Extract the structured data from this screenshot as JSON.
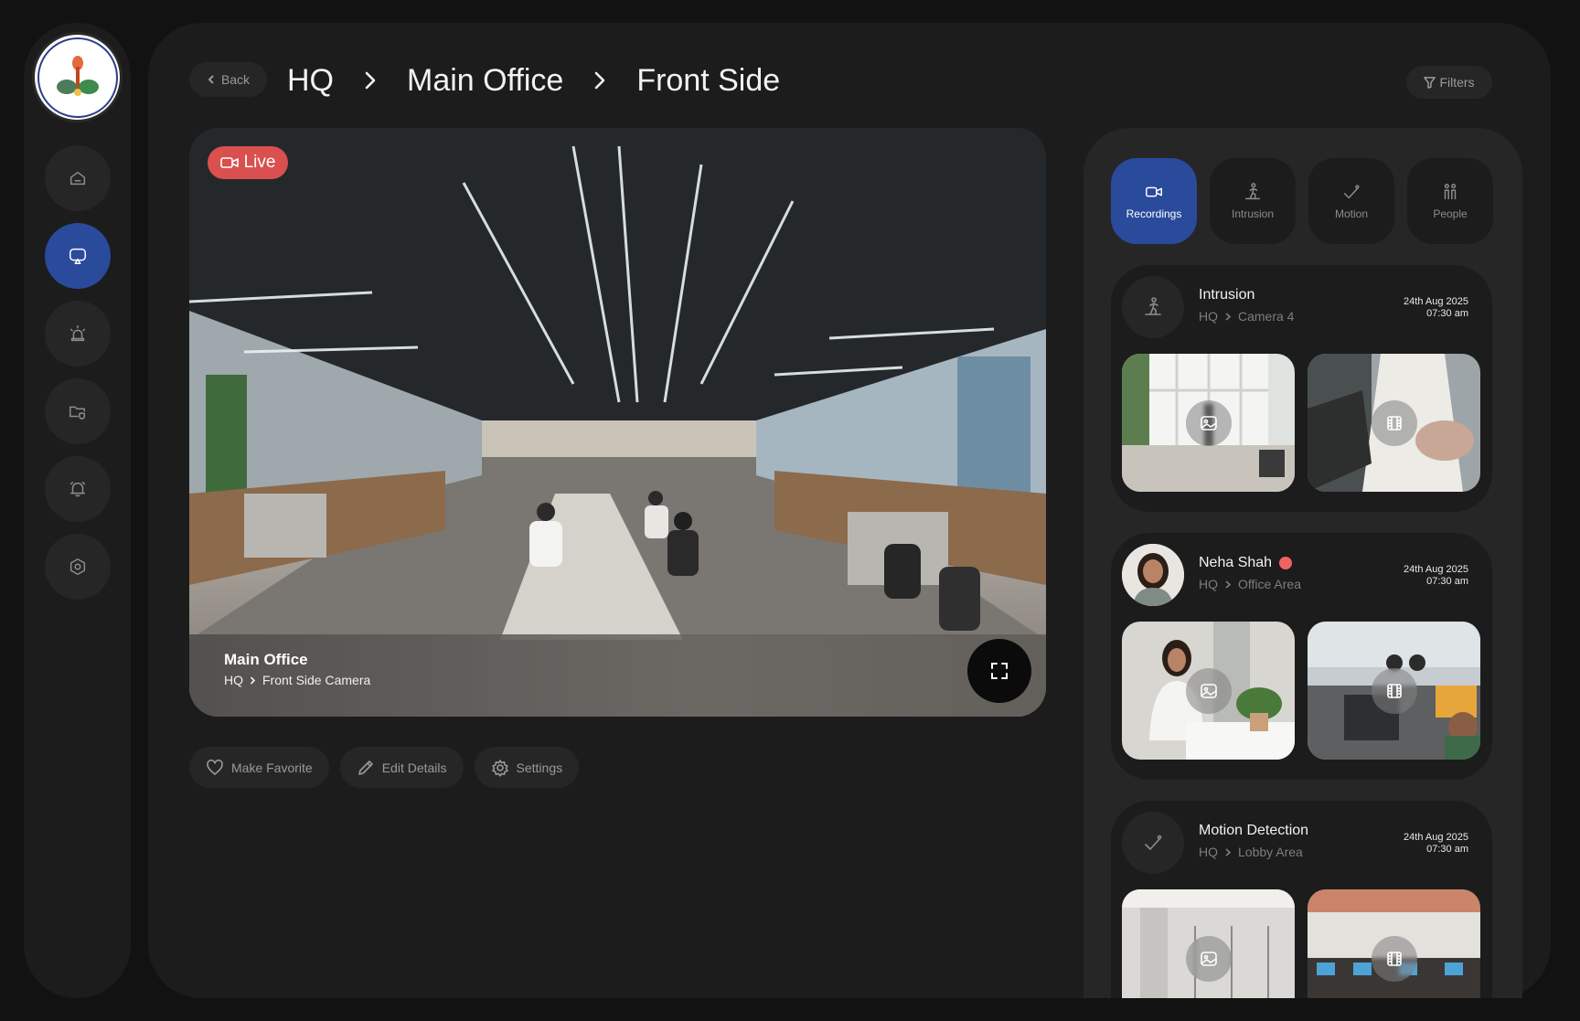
{
  "nav": {
    "items": [
      {
        "id": "home",
        "icon": "home-icon",
        "active": false
      },
      {
        "id": "live",
        "icon": "cast-screen-icon",
        "active": true
      },
      {
        "id": "alerts",
        "icon": "siren-icon",
        "active": false
      },
      {
        "id": "files",
        "icon": "folder-shield-icon",
        "active": false
      },
      {
        "id": "notifications",
        "icon": "bell-icon",
        "active": false
      },
      {
        "id": "settings",
        "icon": "hexagon-settings-icon",
        "active": false
      }
    ],
    "active_color": "#2a4a9c"
  },
  "header": {
    "back_label": "Back",
    "breadcrumb": [
      "HQ",
      "Main Office",
      "Front Side"
    ],
    "filters_label": "Filters"
  },
  "feed": {
    "live_label": "Live",
    "live_color": "#d9504f",
    "title": "Main Office",
    "location": "HQ",
    "camera": "Front Side Camera"
  },
  "actions": {
    "favorite": "Make Favorite",
    "edit": "Edit Details",
    "settings": "Settings"
  },
  "tabs": [
    {
      "label": "Recordings",
      "icon": "video-camera-icon",
      "active": true
    },
    {
      "label": "Intrusion",
      "icon": "intrusion-icon",
      "active": false
    },
    {
      "label": "Motion",
      "icon": "motion-icon",
      "active": false
    },
    {
      "label": "People",
      "icon": "people-icon",
      "active": false
    }
  ],
  "events": [
    {
      "title": "Intrusion",
      "location": "HQ",
      "area": "Camera 4",
      "date": "24th Aug 2025",
      "time": "07:30 am",
      "icon": "intrusion-icon"
    },
    {
      "title": "Neha Shah",
      "location": "HQ",
      "area": "Office Area",
      "date": "24th Aug 2025",
      "time": "07:30 am",
      "status_color": "#ef6461"
    },
    {
      "title": "Motion Detection",
      "location": "HQ",
      "area": "Lobby Area",
      "date": "24th Aug 2025",
      "time": "07:30 am",
      "icon": "motion-icon"
    }
  ]
}
